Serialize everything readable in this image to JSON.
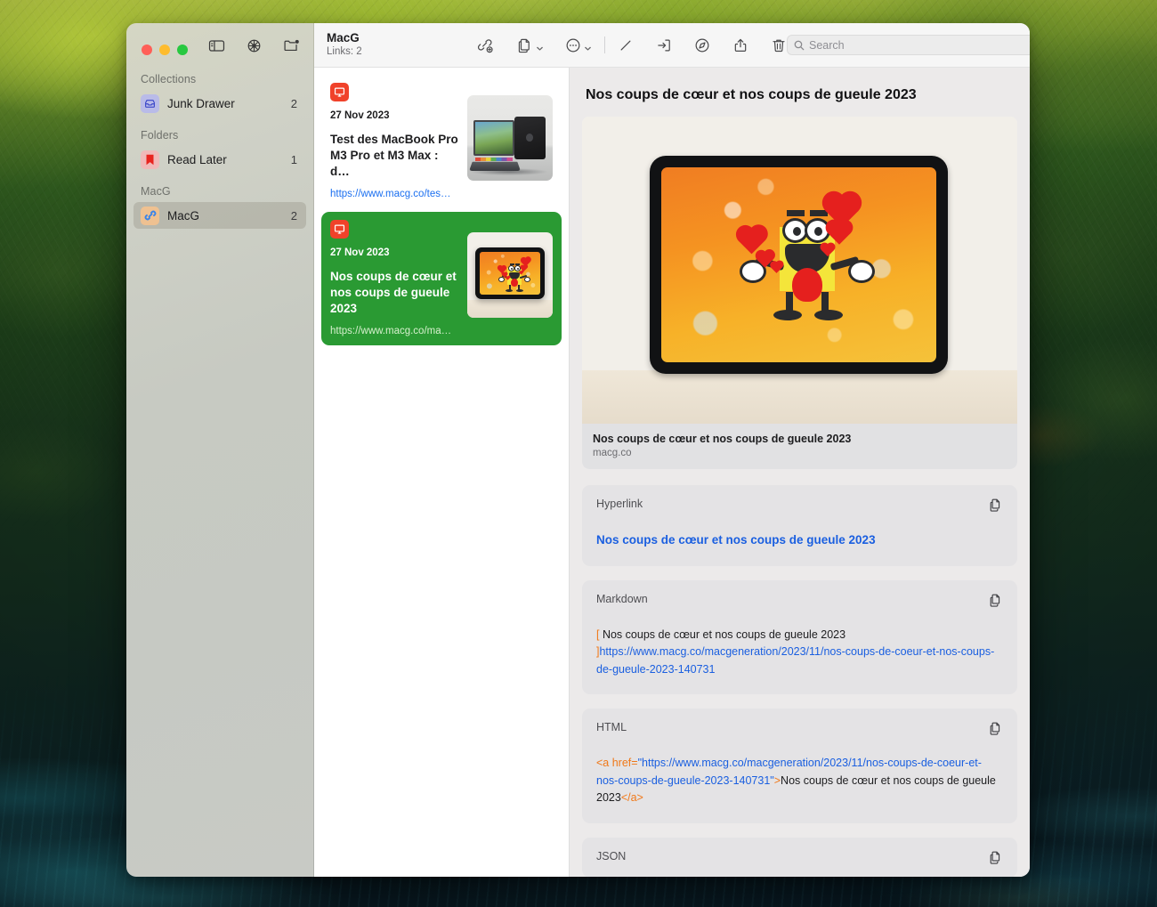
{
  "window": {
    "traffic_lights": [
      "close",
      "minimize",
      "zoom"
    ],
    "sidebar_tools": [
      "sidebar-toggle-icon",
      "gear-icon",
      "new-folder-icon"
    ]
  },
  "sidebar": {
    "sections": [
      {
        "title": "Collections",
        "items": [
          {
            "label": "Junk Drawer",
            "count": "2",
            "icon": "inbox-icon",
            "selected": false
          }
        ]
      },
      {
        "title": "Folders",
        "items": [
          {
            "label": "Read Later",
            "count": "1",
            "icon": "bookmark-icon",
            "selected": false
          }
        ]
      },
      {
        "title": "MacG",
        "items": [
          {
            "label": "MacG",
            "count": "2",
            "icon": "link-icon",
            "selected": true
          }
        ]
      }
    ]
  },
  "toolbar": {
    "title": "MacG",
    "subtitle": "Links: 2",
    "buttons": [
      {
        "name": "add-link-icon",
        "label": "Add Link"
      },
      {
        "name": "copy-documents-icon",
        "label": "Copy"
      },
      {
        "name": "more-options-icon",
        "label": "More"
      },
      {
        "name": "edit-pencil-icon",
        "label": "Edit"
      },
      {
        "name": "open-external-icon",
        "label": "Open"
      },
      {
        "name": "safari-compass-icon",
        "label": "Open in Safari"
      },
      {
        "name": "share-icon",
        "label": "Share"
      },
      {
        "name": "trash-icon",
        "label": "Delete"
      }
    ],
    "search": {
      "placeholder": "Search",
      "value": ""
    }
  },
  "list": {
    "items": [
      {
        "date": "27 Nov 2023",
        "title": "Test des MacBook Pro M3 Pro et M3 Max : d…",
        "url": "https://www.macg.co/tes…",
        "badge": "monitor-icon",
        "selected": false
      },
      {
        "date": "27 Nov 2023",
        "title": "Nos coups de cœur et nos coups de gueule 2023",
        "url": "https://www.macg.co/ma…",
        "badge": "monitor-icon",
        "selected": true
      }
    ]
  },
  "detail": {
    "title": "Nos coups de cœur et nos coups de gueule 2023",
    "preview": {
      "caption_title": "Nos coups de cœur et nos coups de gueule 2023",
      "caption_host": "macg.co",
      "alt": "Tablet displaying a yellow cartoon character surrounded by red hearts"
    },
    "sections": [
      {
        "label": "Hyperlink",
        "copy_icon": "copy-documents-icon",
        "link_text": "Nos coups de cœur et nos coups de gueule 2023"
      },
      {
        "label": "Markdown",
        "copy_icon": "copy-documents-icon",
        "bracket_open": "[",
        "link_title": " Nos coups de cœur et nos coups de gueule 2023 ",
        "bracket_close": "]",
        "url": "https://www.macg.co/macgeneration/2023/11/nos-coups-de-coeur-et-nos-coups-de-gueule-2023-140731"
      },
      {
        "label": "HTML",
        "copy_icon": "copy-documents-icon",
        "tag_open": "<a href=",
        "quote_open": "\"",
        "href": "https://www.macg.co/macgeneration/2023/11/nos-coups-de-coeur-et-nos-coups-de-gueule-2023-140731",
        "quote_close": "\"",
        "gt": ">",
        "text": "Nos coups de cœur et nos coups de gueule 2023",
        "tag_close": "</a>"
      },
      {
        "label": "JSON",
        "copy_icon": "copy-documents-icon"
      }
    ]
  },
  "colors": {
    "selection_green": "#2a9a33",
    "badge_red": "#f0422a",
    "link_blue": "#1a5fe0",
    "token_orange": "#f07818",
    "window_red": "#ff5f57",
    "window_yellow": "#febc2e",
    "window_green": "#28c840"
  }
}
